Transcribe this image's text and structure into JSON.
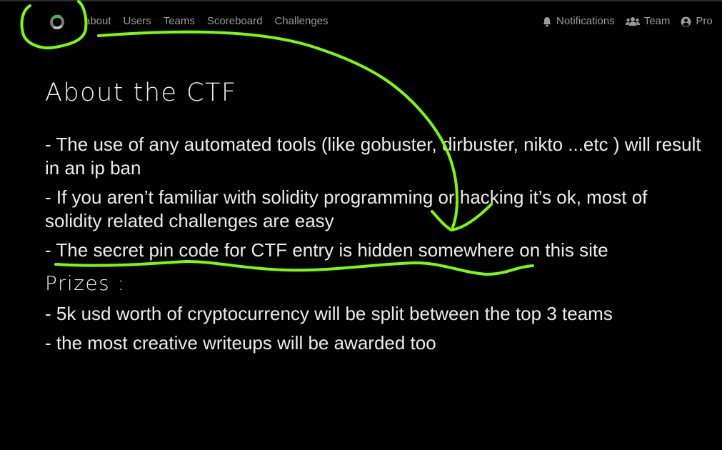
{
  "nav": {
    "left": [
      {
        "name": "nav-about",
        "label": "about"
      },
      {
        "name": "nav-users",
        "label": "Users"
      },
      {
        "name": "nav-teams",
        "label": "Teams"
      },
      {
        "name": "nav-scoreboard",
        "label": "Scoreboard"
      },
      {
        "name": "nav-challenges",
        "label": "Challenges"
      }
    ],
    "right": [
      {
        "name": "nav-notifications",
        "label": "Notifications",
        "icon": "bell-icon"
      },
      {
        "name": "nav-team",
        "label": "Team",
        "icon": "users-icon"
      },
      {
        "name": "nav-profile",
        "label": "Pro",
        "icon": "user-circle-icon"
      }
    ]
  },
  "page": {
    "title": "About the CTF",
    "rules": [
      "- The use of any automated tools (like gobuster, dirbuster, nikto ...etc ) will result in an ip ban",
      "- If you aren’t familiar with solidity programming or hacking it’s ok, most of solidity related challenges are easy",
      "- The secret pin code for CTF entry is hidden somewhere on this site"
    ],
    "prizes_title": "Prizes :",
    "prizes": [
      "- 5k usd worth of cryptocurrency will be split between the top 3 teams",
      "- the most creative writeups will be awarded too"
    ]
  },
  "colors": {
    "background": "#000000",
    "nav_text": "#9a9a9a",
    "body_text": "#ececec",
    "annotation": "#7cfc00"
  }
}
